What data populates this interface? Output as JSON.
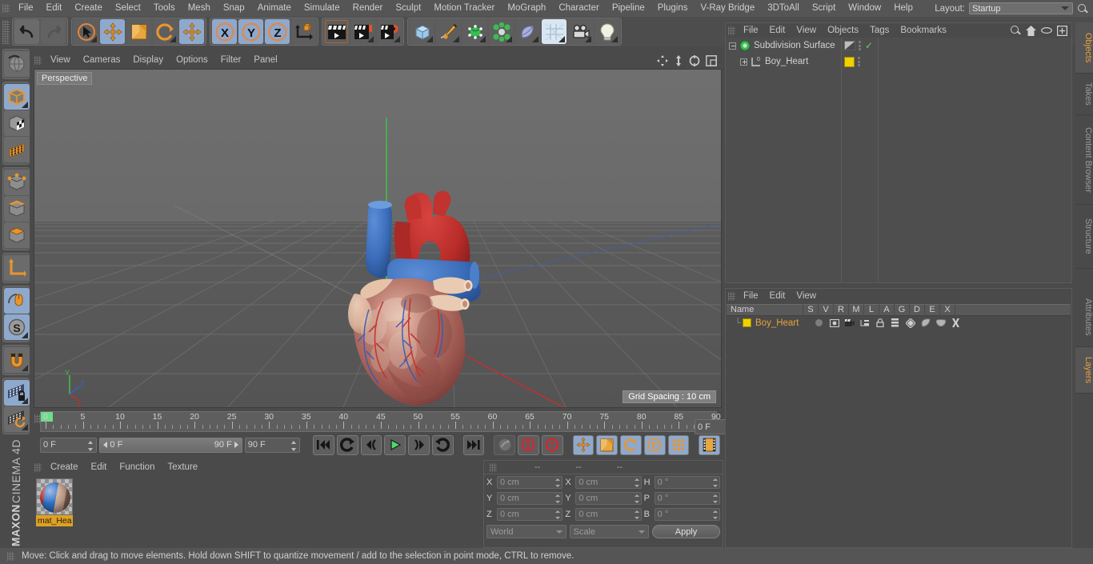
{
  "app": {
    "brand_line1": "MAXON",
    "brand_line2": "CINEMA 4D"
  },
  "menubar": {
    "items": [
      "File",
      "Edit",
      "Create",
      "Select",
      "Tools",
      "Mesh",
      "Snap",
      "Animate",
      "Simulate",
      "Render",
      "Sculpt",
      "Motion Tracker",
      "MoGraph",
      "Character",
      "Pipeline",
      "Plugins",
      "V-Ray Bridge",
      "3DToAll",
      "Script",
      "Window",
      "Help"
    ],
    "layout_label": "Layout:",
    "layout_value": "Startup",
    "search_icon": "search-icon"
  },
  "toolbar": {
    "undo": "undo-icon",
    "redo": "redo-icon",
    "select": "live-selection-icon",
    "move": "move-icon",
    "scale": "scale-icon",
    "rotate": "rotate-icon",
    "move_dup": "move-active-icon",
    "axis_x": "X",
    "axis_y": "Y",
    "axis_z": "Z",
    "world_axis": "world-coordinate-icon",
    "render_view": "render-view-icon",
    "render_picture": "render-to-picture-viewer-icon",
    "render_settings": "render-settings-icon",
    "cube": "add-cube-icon",
    "spline": "add-spline-icon",
    "generator": "add-generator-icon",
    "mograph": "add-mograph-icon",
    "deformer": "add-deformer-icon",
    "scene": "add-scene-icon",
    "camera": "add-camera-icon",
    "light": "add-light-icon"
  },
  "left_tools": [
    {
      "name": "undo-view-icon",
      "active": false
    },
    {
      "name": "object-mode-icon",
      "active": true
    },
    {
      "name": "texture-mode-icon",
      "active": false
    },
    {
      "name": "points-mode-icon",
      "active": false
    },
    {
      "name": "edge-mode-icon",
      "active": false
    },
    {
      "name": "polygon-mode-icon",
      "active": false
    },
    {
      "name": "model-mode-icon",
      "active": false
    },
    {
      "name": "axis-mode-icon",
      "active": false
    },
    {
      "name": "enable-axis-icon",
      "active": false
    },
    {
      "name": "viewport-solo-icon",
      "active": true
    },
    {
      "name": "snap-settings-icon",
      "active": true
    },
    {
      "name": "magnet-icon",
      "active": false
    },
    {
      "name": "lock-workplane-icon",
      "active": true
    },
    {
      "name": "workplane-icon",
      "active": false
    }
  ],
  "viewport": {
    "menu": [
      "View",
      "Cameras",
      "Display",
      "Options",
      "Filter",
      "Panel"
    ],
    "corner_icons": [
      "pan-icon",
      "dolly-icon",
      "rotate-view-icon",
      "maximize-view-icon"
    ],
    "label": "Perspective",
    "grid_spacing": "Grid Spacing : 10 cm",
    "axis_labels": {
      "x": "X",
      "y": "Y",
      "z": "Z"
    },
    "model": "heart-3d-model"
  },
  "timeline": {
    "ticks": [
      0,
      5,
      10,
      15,
      20,
      25,
      30,
      35,
      40,
      45,
      50,
      55,
      60,
      65,
      70,
      75,
      80,
      85,
      90
    ],
    "current_frame_field": "0 F",
    "range_start": "0 F",
    "range_end": "90 F",
    "end_frame_field": "90 F",
    "preview_frame_field": "0 F",
    "buttons": [
      "go-to-start-icon",
      "play-reverse-loop-icon",
      "step-back-icon",
      "play-icon",
      "step-forward-icon",
      "loop-icon",
      "go-to-end-icon",
      "record-auto-icon",
      "record-icon",
      "record-keyframe-icon",
      "key-position-icon",
      "key-scale-icon",
      "key-rotation-icon",
      "key-param-icon",
      "key-points-icon",
      "timeline-mode-icon"
    ]
  },
  "materials": {
    "menu": [
      "Create",
      "Edit",
      "Function",
      "Texture"
    ],
    "items": [
      {
        "name": "mat_Hea",
        "swatch": "heart-material-preview"
      }
    ]
  },
  "coordinates": {
    "headers": [
      "--",
      "--",
      "--"
    ],
    "position": {
      "label_x": "X",
      "label_y": "Y",
      "label_z": "Z",
      "x": "0 cm",
      "y": "0 cm",
      "z": "0 cm"
    },
    "size": {
      "label_x": "X",
      "label_y": "Y",
      "label_z": "Z",
      "x": "0 cm",
      "y": "0 cm",
      "z": "0 cm"
    },
    "rotation": {
      "label_h": "H",
      "label_p": "P",
      "label_b": "B",
      "h": "0 °",
      "p": "0 °",
      "b": "0 °"
    },
    "system": "World",
    "mode": "Scale",
    "apply_label": "Apply"
  },
  "object_manager": {
    "menu": [
      "File",
      "Edit",
      "View",
      "Objects",
      "Tags",
      "Bookmarks"
    ],
    "header_icons": [
      "search-icon",
      "home-icon",
      "eye-icon",
      "new-layout-icon"
    ],
    "rows": [
      {
        "name": "Subdivision Surface",
        "icon": "subdivision-surface-icon",
        "indent": 0,
        "tag": "display-tag",
        "check": "✓"
      },
      {
        "name": "Boy_Heart",
        "icon": "polygon-object-icon",
        "indent": 1,
        "tag": "material-tag",
        "check": ""
      }
    ]
  },
  "layer_manager": {
    "menu": [
      "File",
      "Edit",
      "View"
    ],
    "columns": [
      "Name",
      "S",
      "V",
      "R",
      "M",
      "L",
      "A",
      "G",
      "D",
      "E",
      "X"
    ],
    "rows": [
      {
        "name": "Boy_Heart",
        "color": "#f0d000"
      }
    ]
  },
  "right_tabs_top": [
    {
      "label": "Objects",
      "active": true
    },
    {
      "label": "Takes",
      "active": false
    },
    {
      "label": "Content Browser",
      "active": false
    },
    {
      "label": "Structure",
      "active": false
    }
  ],
  "right_tabs_bottom": [
    {
      "label": "Attributes",
      "active": false
    },
    {
      "label": "Layers",
      "active": true
    }
  ],
  "statusbar": {
    "text": "Move: Click and drag to move elements. Hold down SHIFT to quantize movement / add to the selection in point mode, CTRL to remove."
  },
  "colors": {
    "accent_orange": "#e8a33d",
    "active_blue": "#8fa9cc",
    "panel_bg": "#4a4a4a",
    "toolbar_bg": "#4d4d4d",
    "yellow_swatch": "#f0d000",
    "green_marker": "#6fdc8c"
  }
}
